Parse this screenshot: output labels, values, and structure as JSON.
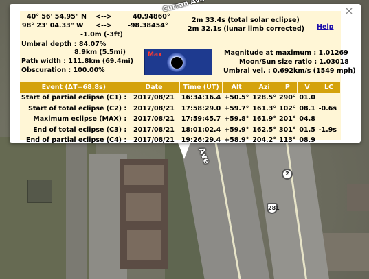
{
  "map": {
    "street_top": "Curran Ave",
    "street_right": "Ave",
    "route_2": "2",
    "route_281": "281"
  },
  "popup": {
    "close_icon": "×",
    "lat": "40° 56' 54.95\" N",
    "lat_arrow": "<-->",
    "lat_dec": "40.94860°",
    "lon": "98° 23' 04.33\" W",
    "lon_arrow": "<-->",
    "lon_dec": "-98.38454°",
    "elevation": "-1.0m (-3ft)",
    "duration_total": "2m 33.4s (total solar eclipse)",
    "duration_limb": "2m 32.1s (lunar limb corrected)",
    "help": "Help",
    "umbral_depth": "Umbral depth : 84.07%",
    "umbral_km": "8.9km (5.5mi)",
    "path_width": "Path width : 111.8km (69.4mi)",
    "obscuration": "Obscuration : 100.00%",
    "diagram_label": "Max",
    "magnitude": "Magnitude at maximum : 1.01269",
    "size_ratio": "Moon/Sun size ratio : 1.03018",
    "umbral_vel": "Umbral vel. : 0.692km/s (1549 mph)"
  },
  "table": {
    "headers": [
      "Event (ΔT=68.8s)",
      "Date",
      "Time (UT)",
      "Alt",
      "Azi",
      "P",
      "V",
      "LC"
    ],
    "rows": [
      [
        "Start of partial eclipse (C1) :",
        "2017/08/21",
        "16:34:16.4",
        "+50.5°",
        "128.5°",
        "290°",
        "01.0",
        ""
      ],
      [
        "Start of total eclipse (C2) :",
        "2017/08/21",
        "17:58:29.0",
        "+59.7°",
        "161.3°",
        "102°",
        "08.1",
        "-0.6s"
      ],
      [
        "Maximum eclipse (MAX) :",
        "2017/08/21",
        "17:59:45.7",
        "+59.8°",
        "161.9°",
        "201°",
        "04.8",
        ""
      ],
      [
        "End of total eclipse (C3) :",
        "2017/08/21",
        "18:01:02.4",
        "+59.9°",
        "162.5°",
        "301°",
        "01.5",
        "-1.9s"
      ],
      [
        "End of partial eclipse (C4) :",
        "2017/08/21",
        "19:26:29.4",
        "+58.9°",
        "204.2°",
        "113°",
        "08.9",
        ""
      ]
    ]
  }
}
